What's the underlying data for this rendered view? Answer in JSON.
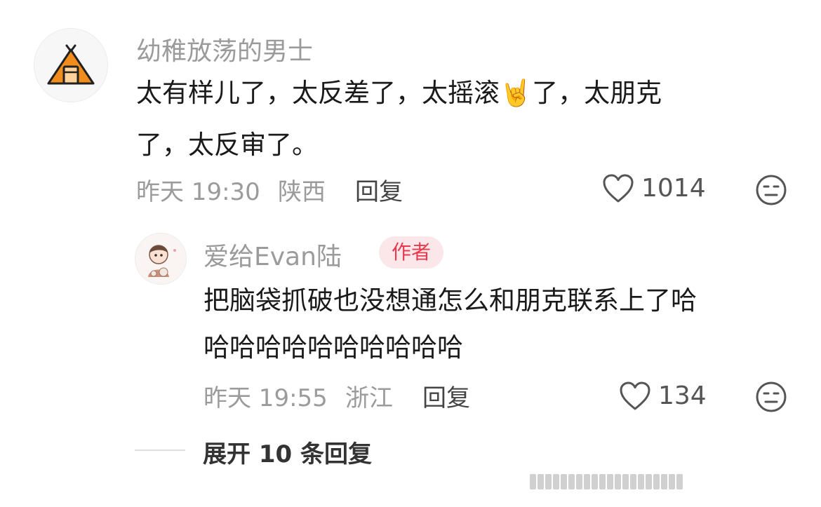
{
  "comment": {
    "username": "幼稚放荡的男士",
    "text_line1": "太有样儿了，太反差了，太摇滚🤘了，太朋克",
    "text_line2": "了，太反审了。",
    "time": "昨天 19:30",
    "location": "陕西",
    "reply_label": "回复",
    "like_count": "1014"
  },
  "reply": {
    "username": "爱给Evan陆",
    "badge": "作者",
    "text_line1": "把脑袋抓破也没想通怎么和朋克联系上了哈",
    "text_line2": "哈哈哈哈哈哈哈哈哈哈",
    "time": "昨天 19:55",
    "location": "浙江",
    "reply_label": "回复",
    "like_count": "134"
  },
  "expand": {
    "label": "展开 10 条回复"
  },
  "colors": {
    "badge_bg": "#fbe7ea",
    "badge_text": "#e8394e",
    "avatar_tent": "#f28c1d"
  },
  "icons": [
    "tent-avatar-icon",
    "heart-icon",
    "face-icon"
  ]
}
